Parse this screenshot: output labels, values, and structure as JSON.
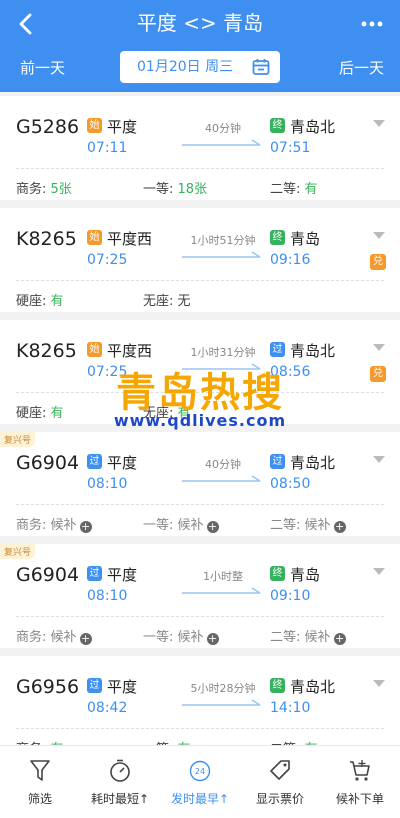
{
  "header": {
    "title": "平度 <> 青岛",
    "prev_day": "前一天",
    "next_day": "后一天",
    "date": "01月20日 周三"
  },
  "trains": [
    {
      "train_no": "G5286",
      "tag": "",
      "from_badge": "始",
      "from": "平度",
      "dep": "07:11",
      "duration": "40分钟",
      "to_badge": "终",
      "to": "青岛北",
      "arr": "07:51",
      "exchange": "",
      "seats": [
        {
          "label": "商务:",
          "value": "5张",
          "plus": false
        },
        {
          "label": "一等:",
          "value": "18张",
          "plus": false
        },
        {
          "label": "二等:",
          "value": "有",
          "plus": false
        }
      ]
    },
    {
      "train_no": "K8265",
      "tag": "",
      "from_badge": "始",
      "from": "平度西",
      "dep": "07:25",
      "duration": "1小时51分钟",
      "to_badge": "终",
      "to": "青岛",
      "arr": "09:16",
      "exchange": "兑",
      "seats": [
        {
          "label": "硬座:",
          "value": "有",
          "plus": false
        },
        {
          "label": "无座:",
          "value": "无",
          "plus": false
        }
      ]
    },
    {
      "train_no": "K8265",
      "tag": "",
      "from_badge": "始",
      "from": "平度西",
      "dep": "07:25",
      "duration": "1小时31分钟",
      "to_badge": "过",
      "to": "青岛北",
      "arr": "08:56",
      "exchange": "兑",
      "seats": [
        {
          "label": "硬座:",
          "value": "有",
          "plus": false
        },
        {
          "label": "无座:",
          "value": "有",
          "plus": false
        }
      ]
    },
    {
      "train_no": "G6904",
      "tag": "复兴号",
      "from_badge": "过",
      "from": "平度",
      "dep": "08:10",
      "duration": "40分钟",
      "to_badge": "过",
      "to": "青岛北",
      "arr": "08:50",
      "exchange": "",
      "seats": [
        {
          "label": "商务:",
          "value": "候补",
          "plus": true
        },
        {
          "label": "一等:",
          "value": "候补",
          "plus": true
        },
        {
          "label": "二等:",
          "value": "候补",
          "plus": true
        }
      ]
    },
    {
      "train_no": "G6904",
      "tag": "复兴号",
      "from_badge": "过",
      "from": "平度",
      "dep": "08:10",
      "duration": "1小时整",
      "to_badge": "终",
      "to": "青岛",
      "arr": "09:10",
      "exchange": "",
      "seats": [
        {
          "label": "商务:",
          "value": "候补",
          "plus": true
        },
        {
          "label": "一等:",
          "value": "候补",
          "plus": true
        },
        {
          "label": "二等:",
          "value": "候补",
          "plus": true
        }
      ]
    },
    {
      "train_no": "G6956",
      "tag": "",
      "from_badge": "过",
      "from": "平度",
      "dep": "08:42",
      "duration": "5小时28分钟",
      "to_badge": "终",
      "to": "青岛北",
      "arr": "14:10",
      "exchange": "",
      "seats": [
        {
          "label": "商务:",
          "value": "有",
          "plus": false
        },
        {
          "label": "一等:",
          "value": "有",
          "plus": false
        },
        {
          "label": "二等:",
          "value": "有",
          "plus": false
        }
      ]
    }
  ],
  "watermark": {
    "title": "青岛热搜",
    "url": "www.qdlives.com"
  },
  "bottom_tabs": [
    {
      "label": "筛选",
      "icon": "filter-icon",
      "active": false
    },
    {
      "label": "耗时最短↑",
      "icon": "stopwatch-icon",
      "active": false
    },
    {
      "label": "发时最早↑",
      "icon": "clock-24-icon",
      "active": true,
      "icon_text": "24"
    },
    {
      "label": "显示票价",
      "icon": "price-tag-icon",
      "active": false
    },
    {
      "label": "候补下单",
      "icon": "cart-icon",
      "active": false
    }
  ],
  "colors": {
    "primary": "#3e8ff0",
    "available": "#35b35c",
    "start_badge": "#f39a2b",
    "watermark": "#f6a600"
  }
}
